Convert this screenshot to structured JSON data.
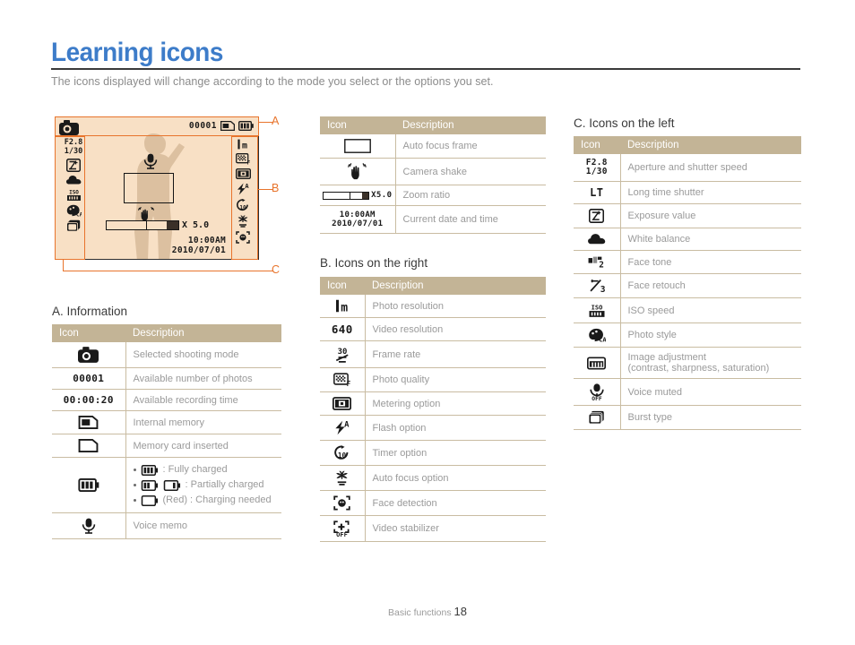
{
  "header": {
    "title": "Learning icons",
    "subtitle": "The icons displayed will change according to the mode you select or the options you set."
  },
  "lcd": {
    "available_shots": "00001",
    "aperture": "F2.8",
    "shutter": "1/30",
    "zoom_ratio": "X 5.0",
    "time": "10:00AM",
    "date": "2010/07/01",
    "mode_icon": "shooting-mode-program-icon",
    "memory_icon": "internal-memory-icon",
    "battery_icon": "battery-full-icon",
    "left_icons": [
      "exposure-value-icon",
      "white-balance-icon",
      "iso-speed-icon",
      "photo-style-icon",
      "burst-type-icon"
    ],
    "right_icons": [
      "photo-resolution-icon",
      "photo-quality-icon",
      "metering-option-icon",
      "flash-option-icon",
      "timer-option-icon",
      "auto-focus-option-icon",
      "face-detection-icon"
    ],
    "center_icons": [
      "voice-memo-icon",
      "auto-focus-frame",
      "camera-shake-icon"
    ],
    "markers": {
      "a": "A",
      "b": "B",
      "c": "C"
    }
  },
  "tables": {
    "columns": {
      "icon": "Icon",
      "description": "Description"
    },
    "middle_top": {
      "rows": [
        {
          "icon": "auto-focus-frame-icon",
          "desc": "Auto focus frame"
        },
        {
          "icon": "camera-shake-icon",
          "desc": "Camera shake"
        },
        {
          "icon": "zoom-ratio-icon",
          "icon_text": "X5.0",
          "desc": "Zoom ratio"
        },
        {
          "icon": "date-time-icon",
          "icon_text_1": "10:00AM",
          "icon_text_2": "2010/07/01",
          "desc": "Current date and time"
        }
      ]
    },
    "a": {
      "heading": "A. Information",
      "rows": [
        {
          "icon": "shooting-mode-icon",
          "desc": "Selected shooting mode"
        },
        {
          "icon": "shot-count-icon",
          "icon_text": "00001",
          "desc": "Available number of photos"
        },
        {
          "icon": "recording-time-icon",
          "icon_text": "00:00:20",
          "desc": "Available recording time"
        },
        {
          "icon": "internal-memory-icon",
          "desc": "Internal memory"
        },
        {
          "icon": "memory-card-icon",
          "desc": "Memory card inserted"
        },
        {
          "icon": "battery-icon",
          "desc": "",
          "battery_states": [
            {
              "label": ": Fully charged",
              "level": 3
            },
            {
              "label": ": Partially charged",
              "level": 2,
              "level2": 1
            },
            {
              "label": "(Red) : Charging needed",
              "level": 0
            }
          ]
        },
        {
          "icon": "voice-memo-icon",
          "desc": "Voice memo"
        }
      ]
    },
    "b": {
      "heading": "B. Icons on the right",
      "rows": [
        {
          "icon": "photo-resolution-icon",
          "desc": "Photo resolution"
        },
        {
          "icon": "video-resolution-icon",
          "icon_text": "640",
          "desc": "Video resolution"
        },
        {
          "icon": "frame-rate-icon",
          "desc": "Frame rate"
        },
        {
          "icon": "photo-quality-icon",
          "desc": "Photo quality"
        },
        {
          "icon": "metering-option-icon",
          "desc": "Metering option"
        },
        {
          "icon": "flash-option-icon",
          "desc": "Flash option"
        },
        {
          "icon": "timer-option-icon",
          "desc": "Timer option"
        },
        {
          "icon": "auto-focus-option-icon",
          "desc": "Auto focus option"
        },
        {
          "icon": "face-detection-icon",
          "desc": "Face detection"
        },
        {
          "icon": "video-stabilizer-icon",
          "desc": "Video stabilizer"
        }
      ]
    },
    "c": {
      "heading": "C. Icons on the left",
      "rows": [
        {
          "icon": "aperture-shutter-icon",
          "icon_text_1": "F2.8",
          "icon_text_2": "1/30",
          "desc": "Aperture and shutter speed"
        },
        {
          "icon": "long-time-shutter-icon",
          "icon_text": "LT",
          "desc": "Long time shutter"
        },
        {
          "icon": "exposure-value-icon",
          "desc": "Exposure value"
        },
        {
          "icon": "white-balance-icon",
          "desc": "White balance"
        },
        {
          "icon": "face-tone-icon",
          "desc": "Face tone"
        },
        {
          "icon": "face-retouch-icon",
          "desc": "Face retouch"
        },
        {
          "icon": "iso-speed-icon",
          "desc": "ISO speed"
        },
        {
          "icon": "photo-style-icon",
          "desc": "Photo style"
        },
        {
          "icon": "image-adjustment-icon",
          "desc": "Image adjustment",
          "desc2": "(contrast, sharpness, saturation)"
        },
        {
          "icon": "voice-muted-icon",
          "desc": "Voice muted"
        },
        {
          "icon": "burst-type-icon",
          "desc": "Burst type"
        }
      ]
    }
  },
  "footer": {
    "label": "Basic functions",
    "page": "18"
  },
  "colors": {
    "title_blue": "#3d7cc9",
    "marker_orange": "#e8742c",
    "table_header_tan": "#c3b496",
    "lcd_background": "#f8e0c5",
    "silhouette": "#dcc0a0"
  }
}
